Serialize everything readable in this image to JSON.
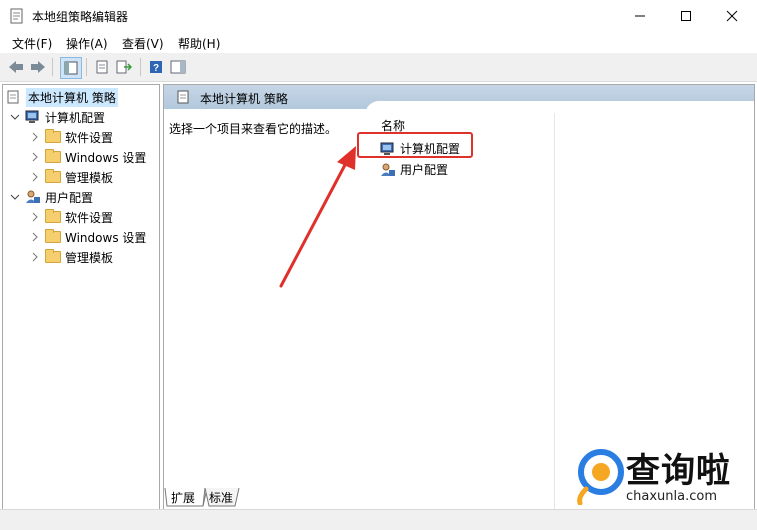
{
  "window": {
    "title": "本地组策略编辑器"
  },
  "menu": [
    "文件(F)",
    "操作(A)",
    "查看(V)",
    "帮助(H)"
  ],
  "toolbar": {
    "icons": [
      "back-arrow-icon",
      "forward-arrow-icon",
      "show-tree-icon",
      "properties-icon",
      "export-list-icon",
      "help-icon",
      "show-hide-action-pane-icon"
    ]
  },
  "tree": {
    "root": "本地计算机 策略",
    "computer": "计算机配置",
    "computer_children": [
      "软件设置",
      "Windows 设置",
      "管理模板"
    ],
    "user": "用户配置",
    "user_children": [
      "软件设置",
      "Windows 设置",
      "管理模板"
    ]
  },
  "right": {
    "title": "本地计算机 策略",
    "description": "选择一个项目来查看它的描述。",
    "column_name": "名称",
    "items": [
      "计算机配置",
      "用户配置"
    ]
  },
  "tabs": [
    "扩展",
    "标准"
  ],
  "watermark": {
    "brand": "查询啦",
    "domain": "chaxunla.com"
  },
  "colors": {
    "highlight": "#e0302a",
    "arrow": "#e0302a",
    "selection": "#cce8ff"
  }
}
